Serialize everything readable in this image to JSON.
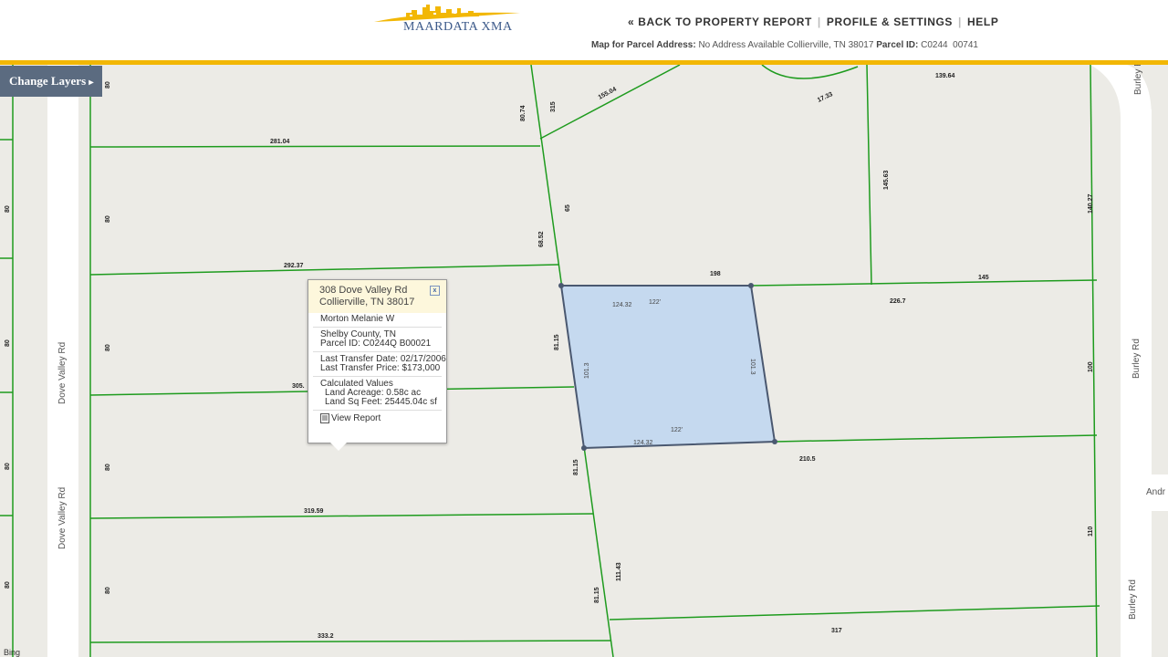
{
  "header": {
    "logo_text": "MAARDATA XMA",
    "nav": {
      "back": "« BACK TO PROPERTY REPORT",
      "profile": "PROFILE & SETTINGS",
      "help": "HELP"
    },
    "parcel_label": "Map for Parcel Address:",
    "parcel_address": "No Address Available Collierville, TN 38017",
    "parcel_id_label": "Parcel ID:",
    "parcel_id": "C0244  00741"
  },
  "layers_button": "Change Layers",
  "popup": {
    "address_line1": "308 Dove Valley Rd",
    "address_line2": "Collierville, TN 38017",
    "close": "x",
    "owner": "Morton Melanie W",
    "county": "Shelby County, TN",
    "parcel_id": "Parcel ID: C0244Q B00021",
    "last_transfer_date": "Last Transfer Date: 02/17/2006",
    "last_transfer_price": "Last Transfer Price: $173,000",
    "calc_header": "Calculated Values",
    "land_acreage": "Land Acreage: 0.58c ac",
    "land_sqft": "Land Sq Feet: 25445.04c sf",
    "view_report": "View Report"
  },
  "map": {
    "streets": [
      "Dove Valley Rd",
      "Dove Valley Rd",
      "Burley Rd",
      "Burley Rd",
      "Burley Rd",
      "Andr"
    ],
    "selected_color": "#c5d9ef",
    "parcel_line_color": "#1e9b1e",
    "selected_outline_color": "#4a5870",
    "dimensions": [
      "80",
      "80",
      "80",
      "80",
      "80",
      "80",
      "80",
      "80",
      "80",
      "80",
      "281.04",
      "292.37",
      "305.",
      "319.59",
      "333.2",
      "80.74",
      "315",
      "155.04",
      "17.33",
      "139.64",
      "145.63",
      "140.27",
      "65",
      "68.52",
      "198",
      "145",
      "124.32",
      "122'",
      "101.3",
      "101.3",
      "226.7",
      "81.15",
      "100",
      "122'",
      "124.32",
      "210.5",
      "81.15",
      "111.43",
      "81.15",
      "110",
      "317"
    ]
  },
  "footer": {
    "bing": "Bing"
  }
}
